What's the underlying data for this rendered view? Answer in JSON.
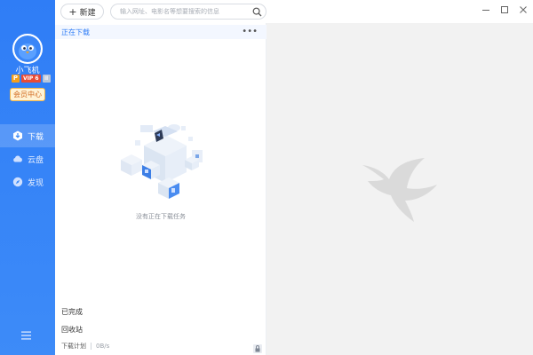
{
  "toolbar": {
    "new_label": "新建",
    "search_placeholder": "输入网址、电影名等想要搜索的信息"
  },
  "user": {
    "name": "小飞机",
    "vip_level": "VIP 6",
    "member_center": "会员中心"
  },
  "nav": {
    "items": [
      {
        "label": "下载",
        "icon": "download-icon",
        "active": true
      },
      {
        "label": "云盘",
        "icon": "cloud-icon",
        "active": false
      },
      {
        "label": "发现",
        "icon": "compass-icon",
        "active": false
      }
    ]
  },
  "download_panel": {
    "section_title": "正在下载",
    "empty_message": "没有正在下载任务",
    "finished": "已完成",
    "recycle_bin": "回收站",
    "plan": "下载计划",
    "speed": "0B/s"
  },
  "colors": {
    "accent": "#2f7df6",
    "sidebar": "#3d8bf8",
    "member_text": "#d2691e"
  }
}
